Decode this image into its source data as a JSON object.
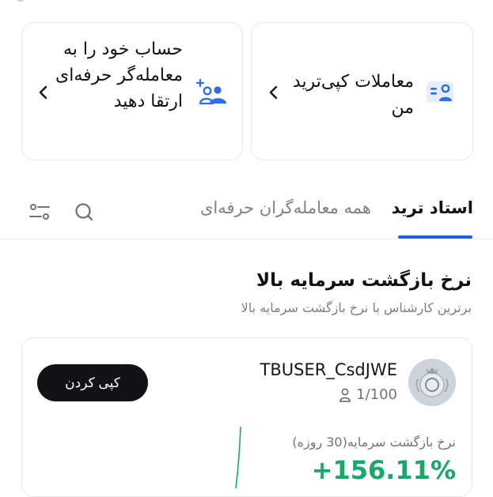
{
  "cards": {
    "copy_trades": {
      "label": "معاملات کپی‌ترید من"
    },
    "upgrade": {
      "label": "حساب خود را به معامله‌گر حرفه‌ای ارتقا دهید"
    }
  },
  "tabs": [
    {
      "label": "استاد ترید",
      "active": true
    },
    {
      "label": "همه معامله‌گران حرفه‌ای",
      "active": false
    }
  ],
  "section": {
    "title": "نرخ بازگشت سرمایه بالا",
    "subtitle": "برترین کارشناس با نرخ بازگشت سرمایه بالا"
  },
  "trader": {
    "name": "TBUSER_CsdJWE",
    "followers": "1/100",
    "copy_button": "کپی کردن",
    "roi_label": "نرخ بازگشت سرمایه(30 روزه)",
    "roi_value": "+156.11%"
  },
  "colors": {
    "accent": "#1f5fe0",
    "positive": "#17a86b",
    "button": "#121316"
  }
}
